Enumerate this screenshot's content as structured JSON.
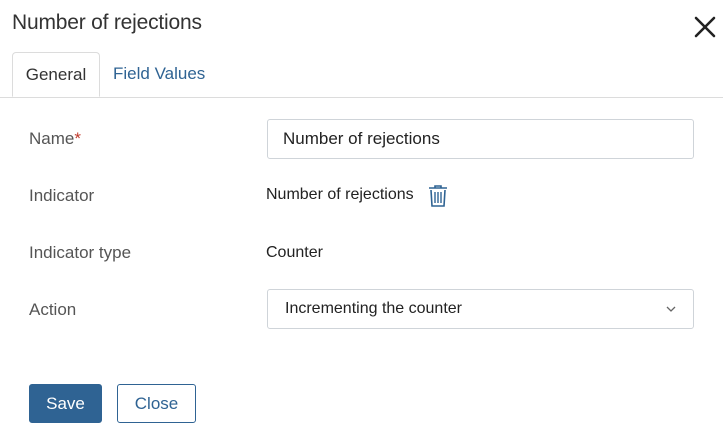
{
  "dialog": {
    "title": "Number of rejections",
    "close_icon": "close-icon"
  },
  "tabs": [
    {
      "label": "General",
      "active": true
    },
    {
      "label": "Field Values",
      "active": false
    }
  ],
  "form": {
    "name": {
      "label": "Name",
      "required_mark": "*",
      "value": "Number of rejections"
    },
    "indicator": {
      "label": "Indicator",
      "value": "Number of rejections",
      "icon": "trash-icon"
    },
    "indicator_type": {
      "label": "Indicator type",
      "value": "Counter"
    },
    "action": {
      "label": "Action",
      "selected": "Incrementing the counter",
      "icon": "chevron-down-icon"
    }
  },
  "buttons": {
    "save_label": "Save",
    "close_label": "Close"
  },
  "colors": {
    "accent": "#2f6393",
    "required": "#c0392b",
    "text": "#333333",
    "border": "#cfd4d9"
  }
}
